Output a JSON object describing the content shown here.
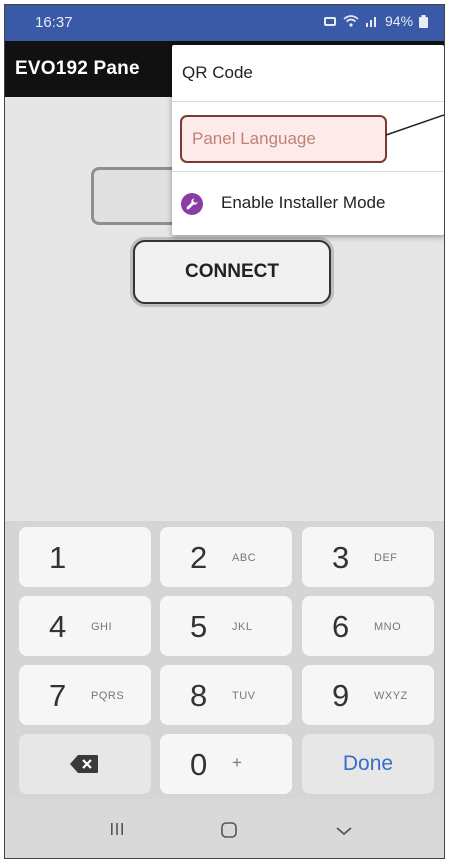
{
  "status_bar": {
    "time": "16:37",
    "battery": "94%"
  },
  "app_bar": {
    "title": "EVO192 Pane"
  },
  "main": {
    "connect_label": "CONNECT"
  },
  "menu": {
    "items": [
      {
        "label": "QR Code"
      },
      {
        "label": "Panel Language"
      },
      {
        "label": "Enable Installer Mode",
        "icon": "wrench-icon"
      }
    ]
  },
  "keypad": {
    "keys": [
      {
        "num": "1",
        "letters": ""
      },
      {
        "num": "2",
        "letters": "ABC"
      },
      {
        "num": "3",
        "letters": "DEF"
      },
      {
        "num": "4",
        "letters": "GHI"
      },
      {
        "num": "5",
        "letters": "JKL"
      },
      {
        "num": "6",
        "letters": "MNO"
      },
      {
        "num": "7",
        "letters": "PQRS"
      },
      {
        "num": "8",
        "letters": "TUV"
      },
      {
        "num": "9",
        "letters": "WXYZ"
      },
      {
        "num": "0",
        "letters": "+"
      }
    ],
    "done_label": "Done"
  },
  "colors": {
    "status_bar": "#3a5aa8",
    "app_bar": "#111111",
    "done_blue": "#3a6cc8",
    "installer_icon": "#8a3da6",
    "highlight_border": "#7a3b32"
  }
}
